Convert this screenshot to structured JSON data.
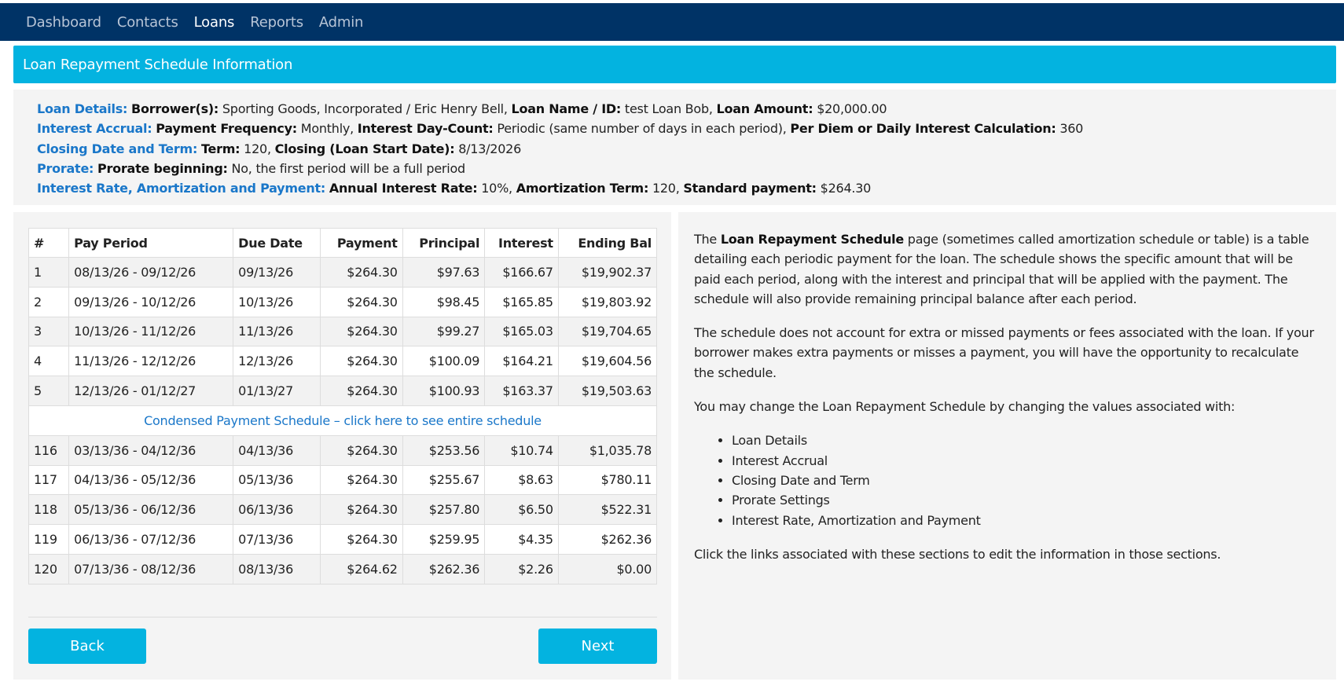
{
  "nav": {
    "items": [
      {
        "label": "Dashboard",
        "active": false
      },
      {
        "label": "Contacts",
        "active": false
      },
      {
        "label": "Loans",
        "active": true
      },
      {
        "label": "Reports",
        "active": false
      },
      {
        "label": "Admin",
        "active": false
      }
    ]
  },
  "title": "Loan Repayment Schedule Information",
  "details": {
    "line1": {
      "section": "Loan Details:",
      "k1": "Borrower(s):",
      "v1": " Sporting Goods, Incorporated / Eric Henry Bell, ",
      "k2": "Loan Name / ID:",
      "v2": " test Loan Bob, ",
      "k3": "Loan Amount:",
      "v3": " $20,000.00"
    },
    "line2": {
      "section": "Interest Accrual:",
      "k1": "Payment Frequency:",
      "v1": " Monthly, ",
      "k2": "Interest Day-Count:",
      "v2": " Periodic (same number of days in each period), ",
      "k3": "Per Diem or Daily Interest Calculation:",
      "v3": " 360"
    },
    "line3": {
      "section": "Closing Date and Term:",
      "k1": "Term:",
      "v1": " 120, ",
      "k2": "Closing (Loan Start Date):",
      "v2": " 8/13/2026"
    },
    "line4": {
      "section": "Prorate:",
      "k1": "Prorate beginning:",
      "v1": " No, the first period will be a full period"
    },
    "line5": {
      "section": "Interest Rate, Amortization and Payment:",
      "k1": "Annual Interest Rate:",
      "v1": " 10%, ",
      "k2": "Amortization Term:",
      "v2": " 120, ",
      "k3": "Standard payment:",
      "v3": " $264.30"
    }
  },
  "table": {
    "headers": [
      "#",
      "Pay Period",
      "Due Date",
      "Payment",
      "Principal",
      "Interest",
      "Ending Bal"
    ],
    "rows_top": [
      [
        "1",
        "08/13/26 - 09/12/26",
        "09/13/26",
        "$264.30",
        "$97.63",
        "$166.67",
        "$19,902.37"
      ],
      [
        "2",
        "09/13/26 - 10/12/26",
        "10/13/26",
        "$264.30",
        "$98.45",
        "$165.85",
        "$19,803.92"
      ],
      [
        "3",
        "10/13/26 - 11/12/26",
        "11/13/26",
        "$264.30",
        "$99.27",
        "$165.03",
        "$19,704.65"
      ],
      [
        "4",
        "11/13/26 - 12/12/26",
        "12/13/26",
        "$264.30",
        "$100.09",
        "$164.21",
        "$19,604.56"
      ],
      [
        "5",
        "12/13/26 - 01/12/27",
        "01/13/27",
        "$264.30",
        "$100.93",
        "$163.37",
        "$19,503.63"
      ]
    ],
    "condensed_link": "Condensed Payment Schedule – click here to see entire schedule",
    "rows_bottom": [
      [
        "116",
        "03/13/36 - 04/12/36",
        "04/13/36",
        "$264.30",
        "$253.56",
        "$10.74",
        "$1,035.78"
      ],
      [
        "117",
        "04/13/36 - 05/12/36",
        "05/13/36",
        "$264.30",
        "$255.67",
        "$8.63",
        "$780.11"
      ],
      [
        "118",
        "05/13/36 - 06/12/36",
        "06/13/36",
        "$264.30",
        "$257.80",
        "$6.50",
        "$522.31"
      ],
      [
        "119",
        "06/13/36 - 07/12/36",
        "07/13/36",
        "$264.30",
        "$259.95",
        "$4.35",
        "$262.36"
      ],
      [
        "120",
        "07/13/36 - 08/12/36",
        "08/13/36",
        "$264.62",
        "$262.36",
        "$2.26",
        "$0.00"
      ]
    ]
  },
  "buttons": {
    "back": "Back",
    "next": "Next"
  },
  "info": {
    "p1_pre": "The ",
    "p1_bold": "Loan Repayment Schedule",
    "p1_post": " page (sometimes called amortization schedule or table) is a table detailing each periodic payment for the loan. The schedule shows the specific amount that will be paid each period, along with the interest and principal that will be applied with the payment. The schedule will also provide remaining principal balance after each period.",
    "p2": "The schedule does not account for extra or missed payments or fees associated with the loan. If your borrower makes extra payments or misses a payment, you will have the opportunity to recalculate the schedule.",
    "p3": "You may change the Loan Repayment Schedule by changing the values associated with:",
    "list": [
      "Loan Details",
      "Interest Accrual",
      "Closing Date and Term",
      "Prorate Settings",
      "Interest Rate, Amortization and Payment"
    ],
    "p4": "Click the links associated with these sections to edit the information in those sections."
  }
}
